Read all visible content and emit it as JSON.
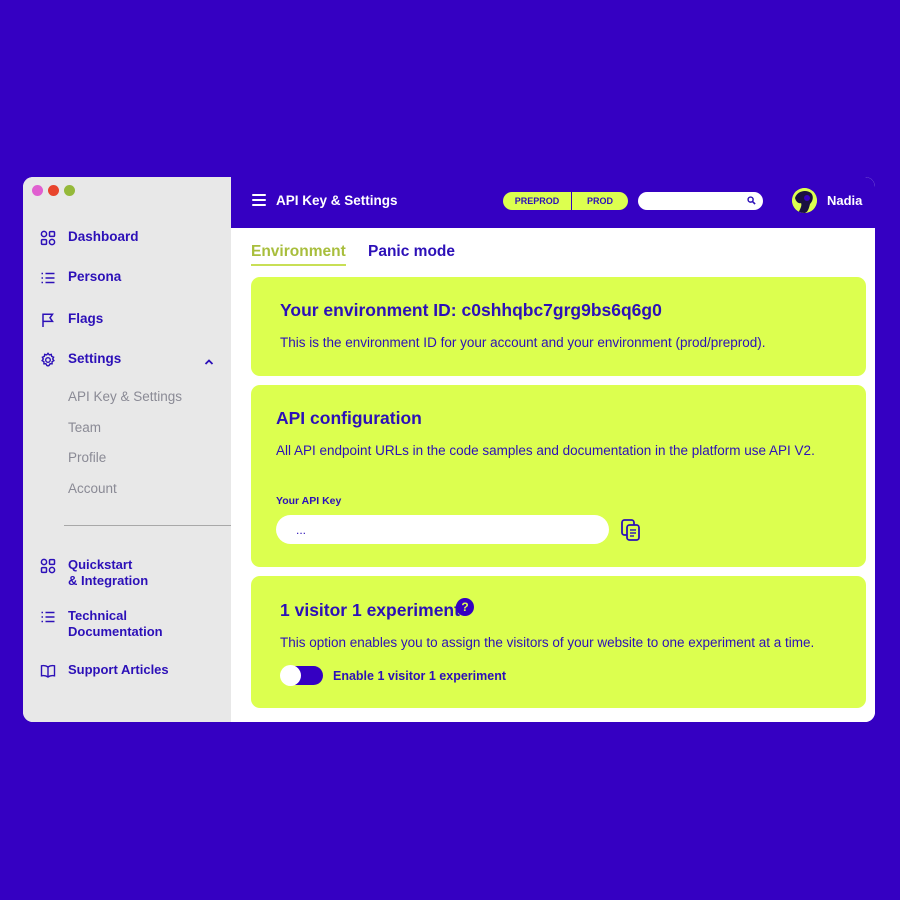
{
  "sidebar": {
    "nav": [
      {
        "label": "Dashboard",
        "icon": "dashboard-icon"
      },
      {
        "label": "Persona",
        "icon": "list-icon"
      },
      {
        "label": "Flags",
        "icon": "flag-icon"
      },
      {
        "label": "Settings",
        "icon": "gear-icon"
      }
    ],
    "settings_sub": [
      "API Key & Settings",
      "Team",
      "Profile",
      "Account"
    ],
    "bottom": [
      {
        "line1": "Quickstart",
        "line2": "& Integration",
        "icon": "quickstart-icon"
      },
      {
        "line1": "Technical",
        "line2": "Documentation",
        "icon": "list-icon"
      },
      {
        "line1": "Support Articles",
        "icon": "book-icon"
      }
    ]
  },
  "topbar": {
    "title": "API Key & Settings",
    "env": {
      "preprod": "PREPROD",
      "prod": "PROD"
    },
    "search_placeholder": "",
    "user": "Nadia"
  },
  "tabs": [
    "Environment",
    "Panic mode"
  ],
  "env_card": {
    "title": "Your environment ID: c0shhqbc7grg9bs6q6g0",
    "text": "This is the environment ID for your account and your environment (prod/preprod)."
  },
  "api_card": {
    "title": "API configuration",
    "text": "All API endpoint URLs in the code samples and documentation in the platform use API V2.",
    "key_label": "Your API Key",
    "key_value": "..."
  },
  "visitor_card": {
    "title": "1 visitor 1 experiment",
    "help": "?",
    "text": "This option enables you to assign the visitors of your website to one experiment at a time.",
    "toggle_label": "Enable 1 visitor 1 experiment",
    "toggle_on": false
  },
  "colors": {
    "brand": "#3500c2",
    "accent": "#dcff4f",
    "text": "#2c10b8"
  }
}
